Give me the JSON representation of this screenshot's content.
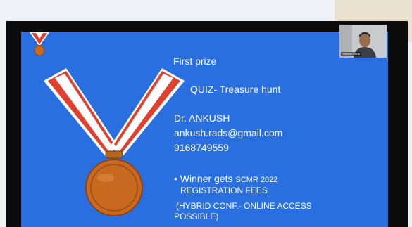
{
  "slide": {
    "title": "First prize",
    "quiz": "QUIZ- Treasure hunt",
    "winner_name": "Dr. ANKUSH",
    "winner_email": "ankush.rads@gmail.com",
    "winner_phone": "9168749559",
    "bullet_prefix": "• Winner gets ",
    "bullet_highlight": "SCMR 2022",
    "bullet_line2": "REGISTRATION FEES",
    "note_line1": "(HYBRID CONF.- ONLINE ACCESS",
    "note_line2": "POSSIBLE)"
  },
  "webcam": {
    "participant_name": "Yashpal Rana"
  },
  "colors": {
    "slide_bg": "#2a6fe0",
    "screen_bg": "#0b0b0b",
    "medal_bronze": "#c8691f",
    "ribbon_red": "#e0412f"
  },
  "icons": {
    "medal_small": "medal-icon",
    "medal_large": "medal-illustration"
  }
}
